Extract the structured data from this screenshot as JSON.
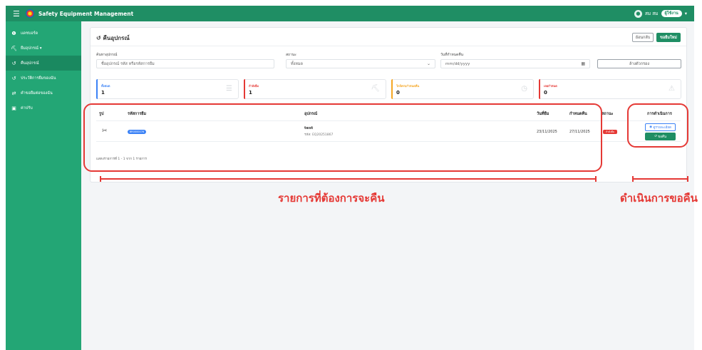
{
  "app": {
    "brand": "Safety Equipment Management",
    "user_name": "สม สม",
    "role_badge": "ผู้ใช้งาน"
  },
  "sidebar": {
    "items": [
      {
        "label": "แดชบอร์ด",
        "icon": "info-icon"
      },
      {
        "label": "ยืมอุปกรณ์ ▾",
        "icon": "shovel-icon"
      },
      {
        "label": "คืนอุปกรณ์",
        "icon": "return-icon"
      },
      {
        "label": "ประวัติการยืมของฉัน",
        "icon": "history-icon"
      },
      {
        "label": "คำขอยืมต่อของฉัน",
        "icon": "swap-icon"
      },
      {
        "label": "ค่าปรับ",
        "icon": "money-icon"
      }
    ]
  },
  "page": {
    "title": "คืนอุปกรณ์",
    "back_button": "ย้อนกลับ",
    "new_button": "ขอยืมใหม่"
  },
  "filters": {
    "search_label": "ค้นหาอุปกรณ์",
    "search_placeholder": "ชื่ออุปกรณ์ รหัส หรือรหัสการยืม",
    "status_label": "สถานะ",
    "status_value": "ทั้งหมด",
    "date_label": "วันที่กำหนดคืน",
    "date_placeholder": "mm/dd/yyyy",
    "clear_button": "ล้างตัวกรอง"
  },
  "stats": [
    {
      "label": "ทั้งหมด",
      "value": "1",
      "color": "#3b82f6",
      "icon": "list-icon"
    },
    {
      "label": "กำลังยืม",
      "value": "1",
      "color": "#e53935",
      "icon": "shovel-icon"
    },
    {
      "label": "ใกล้ครบกำหนดคืน",
      "value": "0",
      "color": "#f5a623",
      "icon": "clock-icon"
    },
    {
      "label": "เลยกำหนด",
      "value": "0",
      "color": "#e53935",
      "icon": "warning-icon"
    }
  ],
  "table": {
    "headers": {
      "image": "รูป",
      "code": "รหัสการยืม",
      "equipment": "อุปกรณ์",
      "borrow_date": "วันที่ยืม",
      "due_date": "กำหนดคืน",
      "status": "สถานะ",
      "actions": "การดำเนินการ"
    },
    "rows": [
      {
        "image_icon": "tools-icon",
        "code": "BR0000076",
        "equipment_name": "test",
        "equipment_code": "รหัส: EQ20251867",
        "borrow_date": "23/11/2025",
        "due_date": "27/11/2025",
        "status": "กำลังยืม",
        "detail_button": "ดูรายละเอียด",
        "return_button": "ขอคืน"
      }
    ],
    "footnote": "แสดงรายการที่ 1 - 1 จาก 1 รายการ"
  },
  "annotations": {
    "left_label": "รายการที่ต้องการจะคืน",
    "right_label": "ดำเนินการขอคืน",
    "color": "#e53935"
  }
}
